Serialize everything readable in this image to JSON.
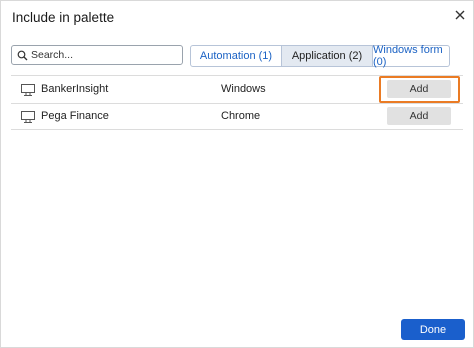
{
  "dialog": {
    "title": "Include in palette"
  },
  "search": {
    "placeholder": "Search..."
  },
  "tabs": [
    {
      "label": "Automation (1)",
      "active": false
    },
    {
      "label": "Application (2)",
      "active": true
    },
    {
      "label": "Windows form (0)",
      "active": false
    }
  ],
  "rows": [
    {
      "name": "BankerInsight",
      "type": "Windows",
      "action": "Add",
      "icon": "monitor-icon",
      "highlighted": true
    },
    {
      "name": "Pega Finance",
      "type": "Chrome",
      "action": "Add",
      "icon": "monitor-icon",
      "highlighted": false
    }
  ],
  "footer": {
    "done_label": "Done"
  },
  "colors": {
    "accent": "#1a5fcc",
    "highlight": "#ea7b24",
    "tab_text": "#1b62c4",
    "active_tab_bg": "#e3e9f1"
  }
}
